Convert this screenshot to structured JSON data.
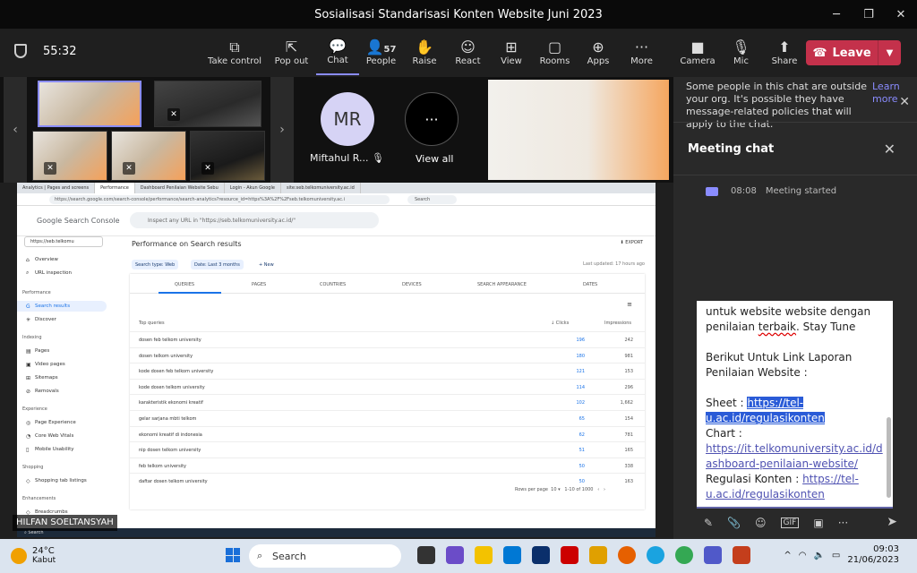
{
  "window": {
    "title": "Sosialisasi Standarisasi Konten Website Juni 2023"
  },
  "meeting": {
    "timer": "55:32"
  },
  "toolbar": {
    "items": [
      {
        "label": "Take control",
        "icon": "take-control-icon"
      },
      {
        "label": "Pop out",
        "icon": "pop-out-icon"
      },
      {
        "label": "Chat",
        "icon": "chat-icon"
      },
      {
        "label": "People",
        "icon": "people-icon",
        "count": "57"
      },
      {
        "label": "Raise",
        "icon": "raise-hand-icon"
      },
      {
        "label": "React",
        "icon": "react-icon"
      },
      {
        "label": "View",
        "icon": "view-icon"
      },
      {
        "label": "Rooms",
        "icon": "rooms-icon"
      },
      {
        "label": "Apps",
        "icon": "apps-icon"
      },
      {
        "label": "More",
        "icon": "more-icon"
      },
      {
        "label": "Camera",
        "icon": "camera-icon"
      },
      {
        "label": "Mic",
        "icon": "mic-off-icon"
      },
      {
        "label": "Share",
        "icon": "share-icon"
      }
    ],
    "leave": "Leave"
  },
  "gallery": {
    "mr_initials": "MR",
    "mr_name": "Miftahul R...",
    "view_all": "View all"
  },
  "browser": {
    "tabs": [
      "Analytics | Pages and screens",
      "Performance",
      "Dashboard Penilaian Website Sebu",
      "Login - Akun Google",
      "site:seb.telkomuniversity.ac.id"
    ],
    "url": "https://search.google.com/search-console/performance/search-analytics?resource_id=https%3A%2F%2Fseb.telkomuniversity.ac.i",
    "search": "Search"
  },
  "gsc": {
    "logo": "Google Search Console",
    "search_placeholder": "Inspect any URL in \"https://seb.telkomuniversity.ac.id/\"",
    "property": "https://seb.telkomu",
    "nav": {
      "overview": "Overview",
      "url_inspection": "URL inspection",
      "performance_h": "Performance",
      "search_results": "Search results",
      "discover": "Discover",
      "indexing_h": "Indexing",
      "pages": "Pages",
      "video_pages": "Video pages",
      "sitemaps": "Sitemaps",
      "removals": "Removals",
      "experience_h": "Experience",
      "page_experience": "Page Experience",
      "cwv": "Core Web Vitals",
      "mobile": "Mobile Usability",
      "shopping_h": "Shopping",
      "shopping_tab": "Shopping tab listings",
      "enh_h": "Enhancements",
      "breadcrumbs": "Breadcrumbs"
    },
    "title": "Performance on Search results",
    "export": "EXPORT",
    "chip1": "Search type: Web",
    "chip2": "Date: Last 3 months",
    "new": "New",
    "last_updated": "Last updated: 17 hours ago",
    "tabs": [
      "QUERIES",
      "PAGES",
      "COUNTRIES",
      "DEVICES",
      "SEARCH APPEARANCE",
      "DATES"
    ],
    "col_query": "Top queries",
    "col_clicks": "Clicks",
    "col_impr": "Impressions",
    "rows": [
      {
        "q": "dosen feb telkom university",
        "c": "196",
        "i": "242"
      },
      {
        "q": "dosen telkom university",
        "c": "180",
        "i": "981"
      },
      {
        "q": "kode dosen feb telkom university",
        "c": "121",
        "i": "153"
      },
      {
        "q": "kode dosen telkom university",
        "c": "114",
        "i": "296"
      },
      {
        "q": "karakteristik ekonomi kreatif",
        "c": "102",
        "i": "1,662"
      },
      {
        "q": "gelar sarjana mbti telkom",
        "c": "65",
        "i": "154"
      },
      {
        "q": "ekonomi kreatif di indonesia",
        "c": "62",
        "i": "781"
      },
      {
        "q": "nip dosen telkom university",
        "c": "51",
        "i": "165"
      },
      {
        "q": "feb telkom university",
        "c": "50",
        "i": "338"
      },
      {
        "q": "daftar dosen telkom university",
        "c": "50",
        "i": "163"
      }
    ],
    "pager_rows": "Rows per page",
    "pager_n": "10",
    "pager_range": "1-10 of 1000"
  },
  "presenter": "HILFAN SOELTANSYAH",
  "chat": {
    "notice": "Some people in this chat are outside your org. It's possible they have message-related policies that will apply to the chat.",
    "learn_more": "Learn more",
    "title": "Meeting chat",
    "started_time": "08:08",
    "started_text": "Meeting started",
    "msg": {
      "l1": "untuk website website dengan",
      "l2a": "penilaian ",
      "l2b": "terbaik",
      "l2c": ". Stay Tune",
      "l3": "Berikut Untuk Link Laporan",
      "l4": "Penilaian Website :",
      "sheet_label": "Sheet : ",
      "sheet_link": "https://tel-u.ac.id/regulasikonten",
      "chart_label": "Chart :",
      "chart_link": "https://it.telkomuniversity.ac.id/dashboard-penilaian-website/",
      "reg_label": "Regulasi Konten : ",
      "reg_link": "https://tel-u.ac.id/regulasikonten"
    }
  },
  "taskbar": {
    "temp": "24°C",
    "cond": "Kabut",
    "search": "Search",
    "time": "09:03",
    "date": "21/06/2023"
  }
}
